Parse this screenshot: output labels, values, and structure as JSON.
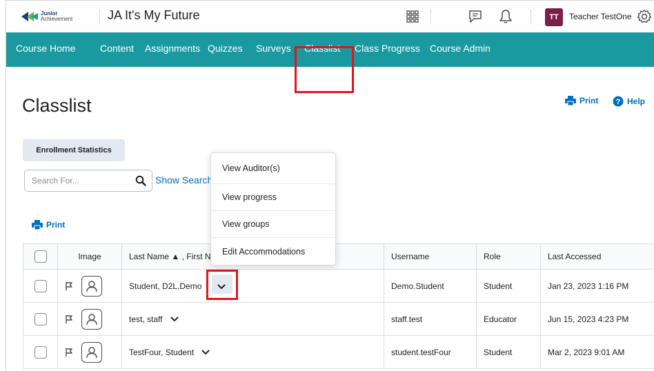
{
  "header": {
    "logo_line1": "Junior",
    "logo_line2": "Achievement",
    "course_title": "JA It's My Future",
    "avatar_initials": "TT",
    "user_name": "Teacher TestOne",
    "icons": [
      "waffle-icon",
      "chat-icon",
      "bell-icon",
      "gear-icon"
    ]
  },
  "nav": {
    "items": [
      "Course Home",
      "Content",
      "Assignments",
      "Quizzes",
      "Surveys",
      "Classlist",
      "Class Progress",
      "Course Admin"
    ],
    "active": "Classlist"
  },
  "page": {
    "title": "Classlist",
    "print_label": "Print",
    "help_label": "Help",
    "enrollment_stats_label": "Enrollment Statistics",
    "search_placeholder": "Search For...",
    "show_search_label": "Show Search",
    "list_print_label": "Print"
  },
  "table": {
    "headers": {
      "image": "Image",
      "name": "Last Name ▲ , First Name",
      "username": "Username",
      "role": "Role",
      "last_accessed": "Last Accessed"
    },
    "rows": [
      {
        "name": "Student, D2L.Demo",
        "username": "Demo.Student",
        "role": "Student",
        "last_accessed": "Jan 23, 2023 1:16 PM"
      },
      {
        "name": "test, staff",
        "username": "staff.test",
        "role": "Educator",
        "last_accessed": "Jun 15, 2023 4:23 PM"
      },
      {
        "name": "TestFour, Student",
        "username": "student.testFour",
        "role": "Student",
        "last_accessed": "Mar 2, 2023 9:01 AM"
      }
    ]
  },
  "context_menu": {
    "items": [
      "View Auditor(s)",
      "View progress",
      "View groups",
      "Edit Accommodations"
    ]
  },
  "colors": {
    "nav_bg": "#1a9aa0",
    "link": "#006fbf",
    "highlight": "#e0141e",
    "avatar_bg": "#7a1f4a"
  }
}
